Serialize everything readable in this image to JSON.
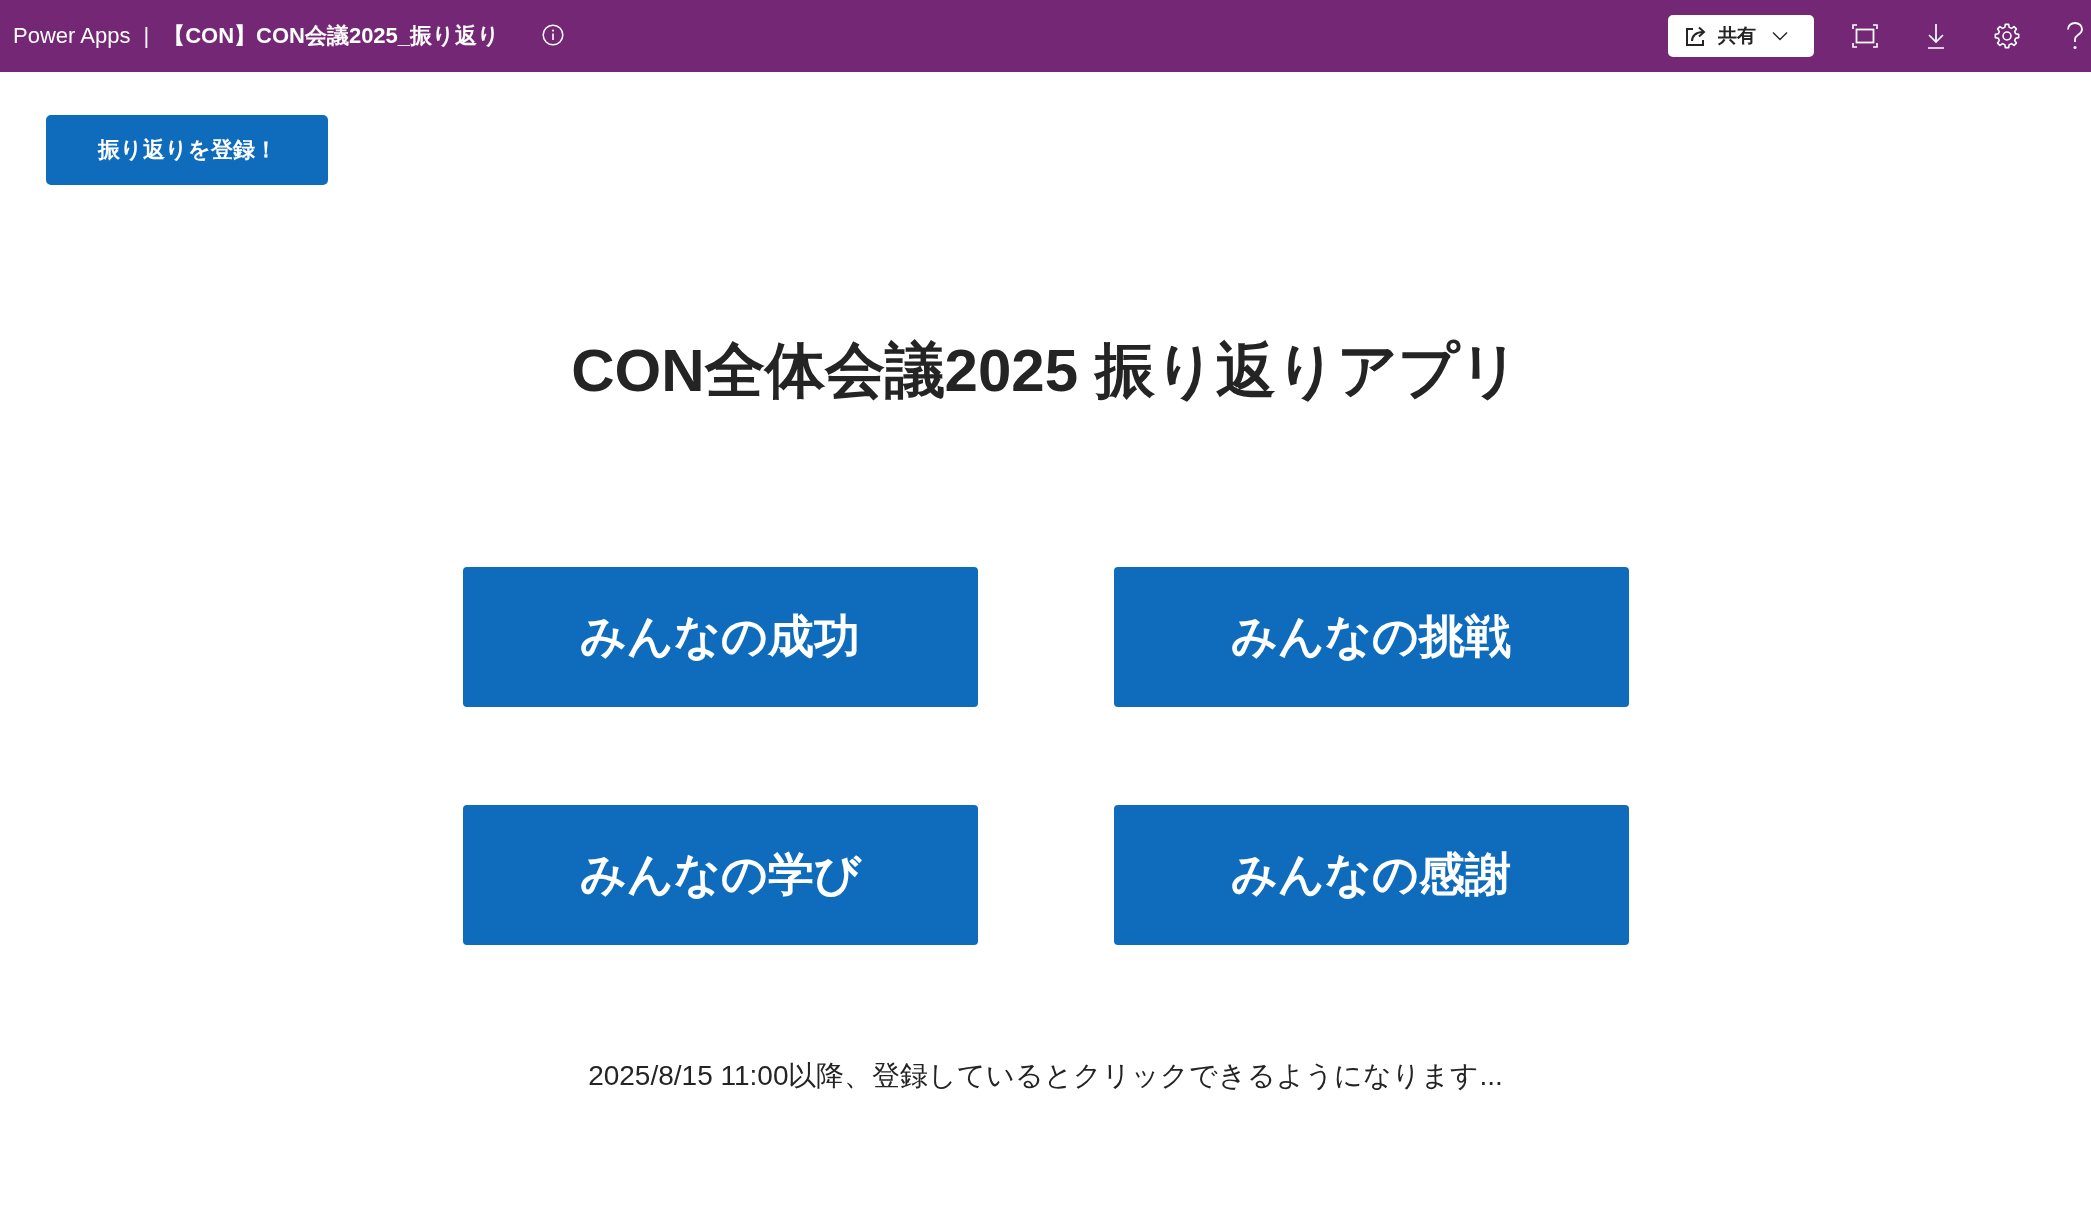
{
  "app_bar": {
    "product": "Power Apps",
    "separator": "|",
    "app_name": "【CON】CON会議2025_振り返り",
    "share_button": {
      "label": "共有"
    }
  },
  "register_button": {
    "label": "振り返りを登録！"
  },
  "heading": "CON全体会議2025 振り返りアプリ",
  "category_buttons": [
    {
      "label": "みんなの成功"
    },
    {
      "label": "みんなの挑戦"
    },
    {
      "label": "みんなの学び"
    },
    {
      "label": "みんなの感謝"
    }
  ],
  "notice": "2025/8/15 11:00以降、登録しているとクリックできるようになります..."
}
